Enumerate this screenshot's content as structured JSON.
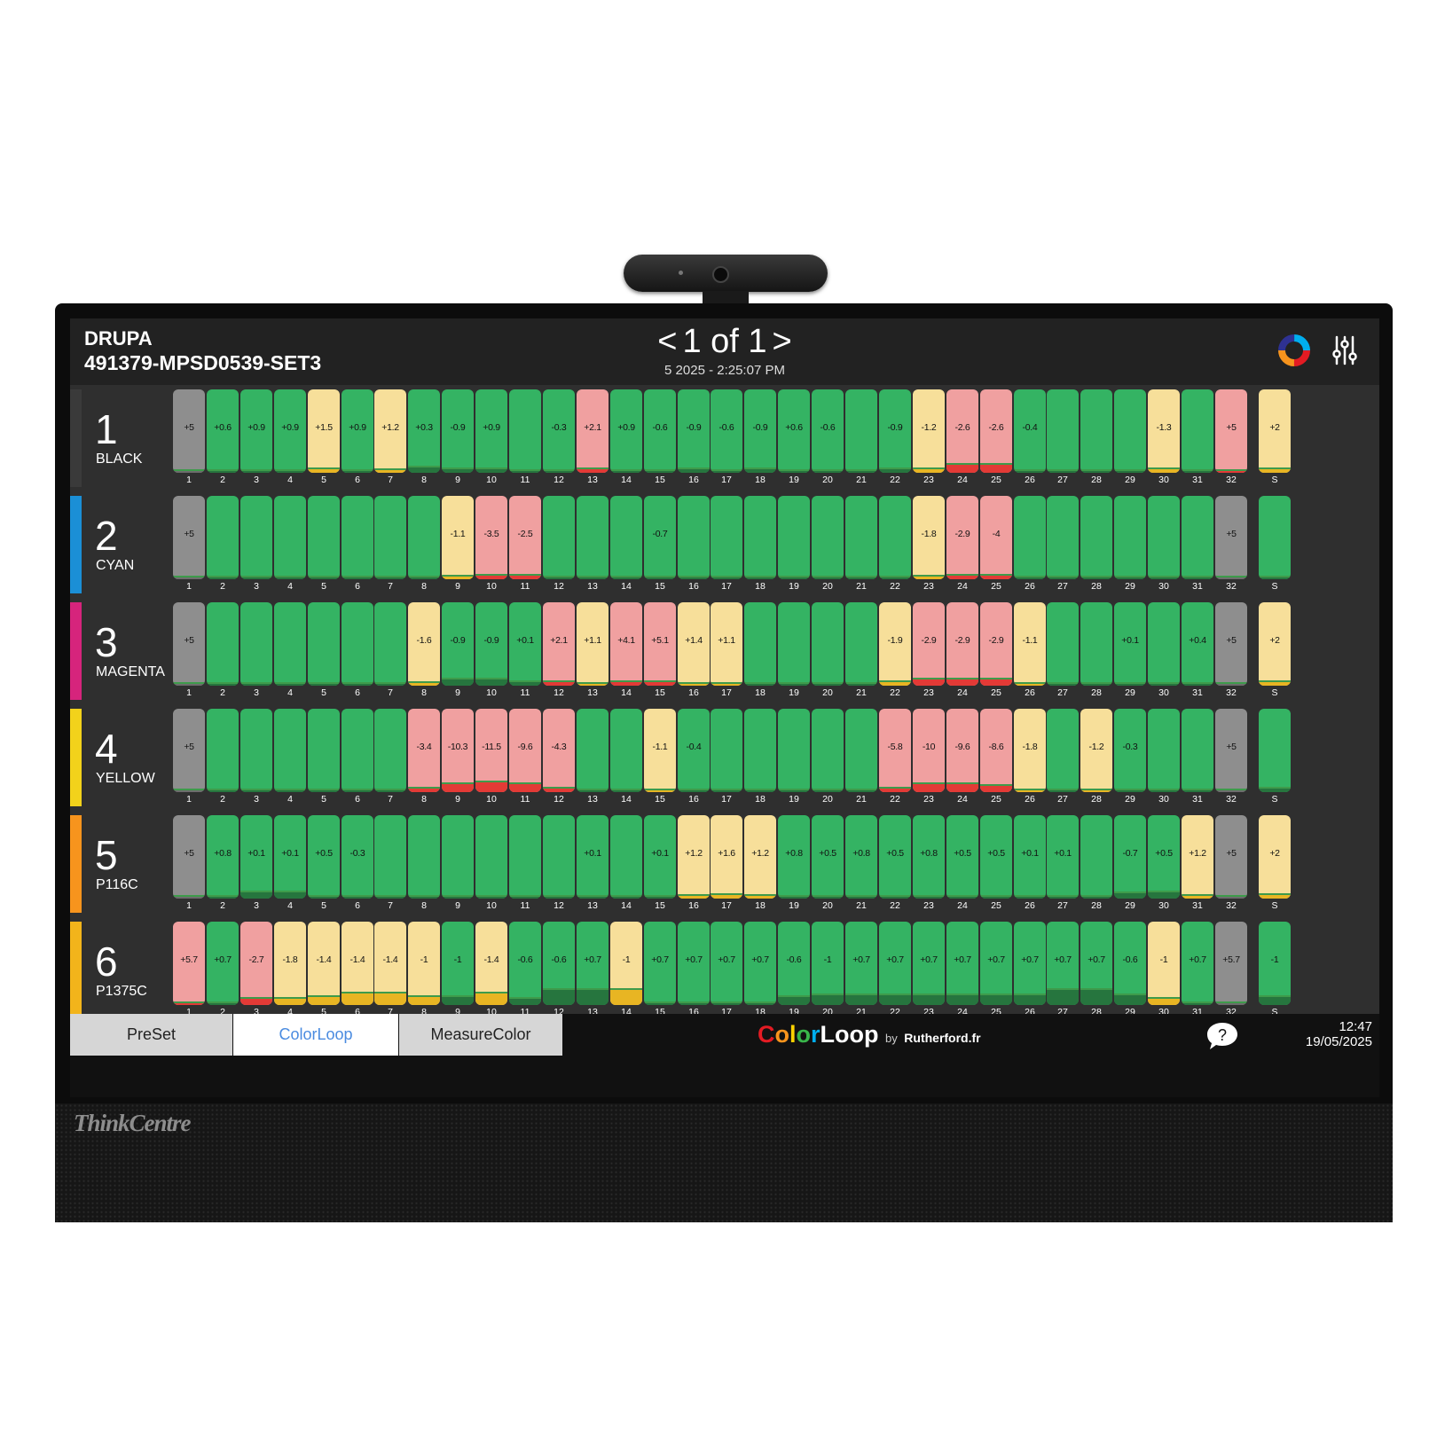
{
  "device": {
    "brand": "ThinkCentre"
  },
  "header": {
    "job_name": "DRUPA",
    "job_id": "491379-MPSD0539-SET3",
    "pager_prev": "<",
    "pager_text": "1 of 1",
    "pager_next": ">",
    "timestamp": "5  2025 - 2:25:07 PM"
  },
  "zone_labels": [
    "1",
    "2",
    "3",
    "4",
    "5",
    "6",
    "7",
    "8",
    "9",
    "10",
    "11",
    "12",
    "13",
    "14",
    "15",
    "16",
    "17",
    "18",
    "19",
    "20",
    "21",
    "22",
    "23",
    "24",
    "25",
    "26",
    "27",
    "28",
    "29",
    "30",
    "31",
    "32",
    "S"
  ],
  "status_colors": {
    "good": "#34b363",
    "warn": "#f7df9a",
    "bad": "#f0a0a0",
    "neutral": "#8e8e8e"
  },
  "rows": [
    {
      "number": "1",
      "name": "BLACK",
      "color": "#3a3a3a",
      "values": [
        "+5",
        "+0.6",
        "+0.9",
        "+0.9",
        "+1.5",
        "+0.9",
        "+1.2",
        "+0.3",
        "-0.9",
        "+0.9",
        "",
        "-0.3",
        "+2.1",
        "+0.9",
        "-0.6",
        "-0.9",
        "-0.6",
        "-0.9",
        "+0.6",
        "-0.6",
        "",
        "-0.9",
        "-1.2",
        "-2.6",
        "-2.6",
        "-0.4",
        "",
        "",
        "",
        "-1.3",
        "",
        "+5",
        "+2"
      ],
      "status": [
        "n",
        "g",
        "g",
        "g",
        "w",
        "g",
        "w",
        "g",
        "g",
        "g",
        "g",
        "g",
        "b",
        "g",
        "g",
        "g",
        "g",
        "g",
        "g",
        "g",
        "g",
        "g",
        "w",
        "b",
        "b",
        "g",
        "g",
        "g",
        "g",
        "w",
        "g",
        "b",
        "w"
      ],
      "levels": [
        0.02,
        0.02,
        0.02,
        0.02,
        0.06,
        0.02,
        0.05,
        0.08,
        0.06,
        0.06,
        0,
        0.02,
        0.06,
        0.02,
        0.04,
        0.06,
        0.04,
        0.06,
        0.02,
        0.04,
        0,
        0.06,
        0.06,
        0.12,
        0.12,
        0.03,
        0,
        0,
        0,
        0.06,
        0,
        0.02,
        0.06
      ]
    },
    {
      "number": "2",
      "name": "CYAN",
      "color": "#1b8fd6",
      "values": [
        "+5",
        "",
        "",
        "",
        "",
        "",
        "",
        "",
        "-1.1",
        "-3.5",
        "-2.5",
        "",
        "",
        "",
        "-0.7",
        "",
        "",
        "",
        "",
        "",
        "",
        "",
        "-1.8",
        "-2.9",
        "-4",
        "",
        "",
        "",
        "",
        "",
        "",
        "+5",
        ""
      ],
      "status": [
        "n",
        "g",
        "g",
        "g",
        "g",
        "g",
        "g",
        "g",
        "w",
        "b",
        "b",
        "g",
        "g",
        "g",
        "g",
        "g",
        "g",
        "g",
        "g",
        "g",
        "g",
        "g",
        "w",
        "b",
        "b",
        "g",
        "g",
        "g",
        "g",
        "g",
        "g",
        "n",
        "g"
      ],
      "levels": [
        0.02,
        0,
        0,
        0,
        0,
        0,
        0,
        0,
        0.05,
        0.06,
        0.06,
        0,
        0,
        0,
        0.03,
        0,
        0,
        0,
        0,
        0,
        0,
        0,
        0.05,
        0.06,
        0.06,
        0,
        0,
        0,
        0,
        0,
        0,
        0.02,
        0
      ]
    },
    {
      "number": "3",
      "name": "MAGENTA",
      "color": "#d6247c",
      "values": [
        "+5",
        "",
        "",
        "",
        "",
        "",
        "",
        "-1.6",
        "-0.9",
        "-0.9",
        "+0.1",
        "+2.1",
        "+1.1",
        "+4.1",
        "+5.1",
        "+1.4",
        "+1.1",
        "",
        "",
        "",
        "",
        "-1.9",
        "-2.9",
        "-2.9",
        "-2.9",
        "-1.1",
        "",
        "",
        "+0.1",
        "",
        "+0.4",
        "+5",
        "+2"
      ],
      "status": [
        "n",
        "g",
        "g",
        "g",
        "g",
        "g",
        "g",
        "w",
        "g",
        "g",
        "g",
        "b",
        "w",
        "b",
        "b",
        "w",
        "w",
        "g",
        "g",
        "g",
        "g",
        "w",
        "b",
        "b",
        "b",
        "w",
        "g",
        "g",
        "g",
        "g",
        "g",
        "n",
        "w"
      ],
      "levels": [
        0.02,
        0,
        0,
        0,
        0,
        0,
        0,
        0.05,
        0.1,
        0.1,
        0.06,
        0.06,
        0.04,
        0.06,
        0.06,
        0.04,
        0.04,
        0,
        0,
        0,
        0,
        0.06,
        0.1,
        0.1,
        0.1,
        0.04,
        0,
        0,
        0.02,
        0,
        0.02,
        0.02,
        0.06
      ]
    },
    {
      "number": "4",
      "name": "YELLOW",
      "color": "#f2d21b",
      "values": [
        "+5",
        "",
        "",
        "",
        "",
        "",
        "",
        "-3.4",
        "-10.3",
        "-11.5",
        "-9.6",
        "-4.3",
        "",
        "",
        "-1.1",
        "-0.4",
        "",
        "",
        "",
        "",
        "",
        "-5.8",
        "-10",
        "-9.6",
        "-8.6",
        "-1.8",
        "",
        "-1.2",
        "-0.3",
        "",
        "",
        "+5",
        ""
      ],
      "status": [
        "n",
        "g",
        "g",
        "g",
        "g",
        "g",
        "g",
        "b",
        "b",
        "b",
        "b",
        "b",
        "g",
        "g",
        "w",
        "g",
        "g",
        "g",
        "g",
        "g",
        "g",
        "b",
        "b",
        "b",
        "b",
        "w",
        "g",
        "w",
        "g",
        "g",
        "g",
        "n",
        "g"
      ],
      "levels": [
        0.02,
        0,
        0,
        0,
        0,
        0,
        0,
        0.06,
        0.12,
        0.14,
        0.12,
        0.06,
        0,
        0,
        0.03,
        0.02,
        0,
        0,
        0,
        0,
        0,
        0.06,
        0.12,
        0.12,
        0.1,
        0.04,
        0,
        0.03,
        0.02,
        0,
        0,
        0.02,
        0.06
      ]
    },
    {
      "number": "5",
      "name": "P116C",
      "color": "#f7941d",
      "values": [
        "+5",
        "+0.8",
        "+0.1",
        "+0.1",
        "+0.5",
        "-0.3",
        "",
        "",
        "",
        "",
        "",
        "",
        "+0.1",
        "",
        "+0.1",
        "+1.2",
        "+1.6",
        "+1.2",
        "+0.8",
        "+0.5",
        "+0.8",
        "+0.5",
        "+0.8",
        "+0.5",
        "+0.5",
        "+0.1",
        "+0.1",
        "",
        "-0.7",
        "+0.5",
        "+1.2",
        "+5",
        "+2"
      ],
      "status": [
        "n",
        "g",
        "g",
        "g",
        "g",
        "g",
        "g",
        "g",
        "g",
        "g",
        "g",
        "g",
        "g",
        "g",
        "g",
        "w",
        "w",
        "w",
        "g",
        "g",
        "g",
        "g",
        "g",
        "g",
        "g",
        "g",
        "g",
        "g",
        "g",
        "g",
        "w",
        "n",
        "w"
      ],
      "levels": [
        0.02,
        0.03,
        0.1,
        0.1,
        0.04,
        0.02,
        0,
        0,
        0,
        0,
        0,
        0,
        0.02,
        0,
        0.02,
        0.05,
        0.06,
        0.05,
        0.03,
        0.02,
        0.03,
        0.02,
        0.03,
        0.02,
        0.02,
        0.02,
        0.02,
        0,
        0.08,
        0.1,
        0.05,
        0.02,
        0.06
      ]
    },
    {
      "number": "6",
      "name": "P1375C",
      "color": "#f2b41b",
      "values": [
        "+5.7",
        "+0.7",
        "-2.7",
        "-1.8",
        "-1.4",
        "-1.4",
        "-1.4",
        "-1",
        "-1",
        "-1.4",
        "-0.6",
        "-0.6",
        "+0.7",
        "-1",
        "+0.7",
        "+0.7",
        "+0.7",
        "+0.7",
        "-0.6",
        "-1",
        "+0.7",
        "+0.7",
        "+0.7",
        "+0.7",
        "+0.7",
        "+0.7",
        "+0.7",
        "+0.7",
        "-0.6",
        "-1",
        "+0.7",
        "+5.7",
        "-1"
      ],
      "status": [
        "b",
        "g",
        "b",
        "w",
        "w",
        "w",
        "w",
        "w",
        "g",
        "w",
        "g",
        "g",
        "g",
        "w",
        "g",
        "g",
        "g",
        "g",
        "g",
        "g",
        "g",
        "g",
        "g",
        "g",
        "g",
        "g",
        "g",
        "g",
        "g",
        "w",
        "g",
        "n",
        "g"
      ],
      "levels": [
        0.03,
        0.02,
        0.1,
        0.1,
        0.12,
        0.16,
        0.16,
        0.12,
        0.12,
        0.16,
        0.1,
        0.2,
        0.2,
        0.2,
        0.02,
        0.02,
        0.02,
        0.02,
        0.12,
        0.14,
        0.14,
        0.14,
        0.14,
        0.14,
        0.14,
        0.14,
        0.2,
        0.2,
        0.14,
        0.1,
        0.02,
        0.02,
        0.12
      ]
    }
  ],
  "bottom": {
    "tabs": [
      {
        "label": "PreSet"
      },
      {
        "label": "ColorLoop"
      },
      {
        "label": "MeasureColor"
      }
    ],
    "logo": {
      "l1": "C",
      "l2": "o",
      "l3": "l",
      "l4": "o",
      "l5": "r",
      "l6": "Loop",
      "by": "by",
      "company": "Rutherford.fr"
    },
    "time": "12:47",
    "date": "19/05/2025"
  },
  "icons": [
    "color-ring-icon",
    "settings-sliders-icon",
    "help-chat-icon",
    "webcam-icon"
  ]
}
